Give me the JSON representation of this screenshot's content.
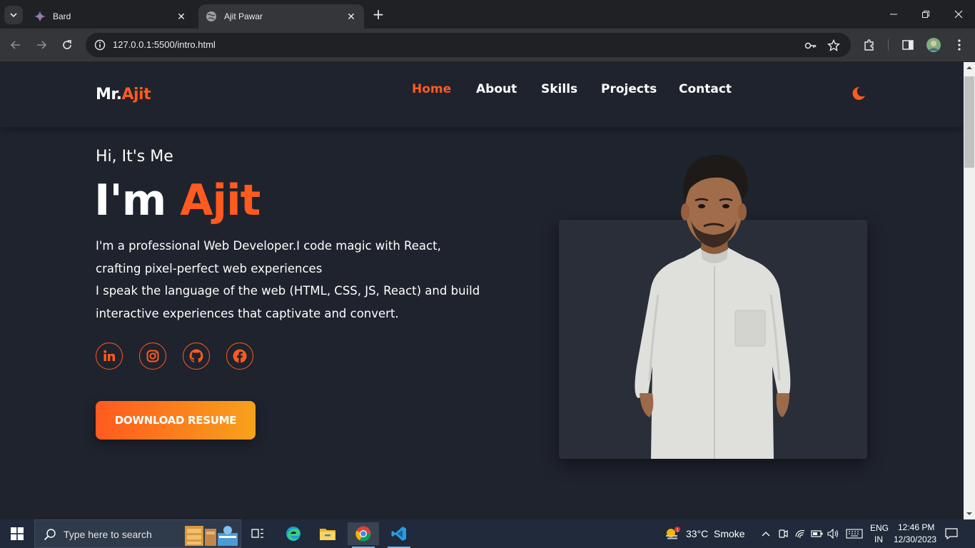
{
  "browser": {
    "tabs": [
      {
        "title": "Bard",
        "icon": "bard-sparkle-icon",
        "active": false
      },
      {
        "title": "Ajit Pawar",
        "icon": "globe-icon",
        "active": true
      }
    ],
    "url": "127.0.0.1:5500/intro.html"
  },
  "site": {
    "logo_prefix": "Mr.",
    "logo_accent": "Ajit",
    "nav": [
      {
        "label": "Home",
        "active": true
      },
      {
        "label": "About",
        "active": false
      },
      {
        "label": "Skills",
        "active": false
      },
      {
        "label": "Projects",
        "active": false
      },
      {
        "label": "Contact",
        "active": false
      }
    ],
    "theme_toggle_icon": "moon-icon"
  },
  "hero": {
    "greeting": "Hi, It's Me",
    "headline_prefix": "I'm ",
    "headline_accent": "Ajit",
    "bio_lines": [
      "I'm a professional Web Developer.I code magic with React,",
      "crafting pixel-perfect web experiences",
      "I speak the language of the web (HTML, CSS, JS, React) and build",
      "interactive experiences that captivate and convert."
    ],
    "social": [
      "linkedin-icon",
      "instagram-icon",
      "github-icon",
      "facebook-icon"
    ],
    "cta_label": "DOWNLOAD RESUME"
  },
  "taskbar": {
    "search_placeholder": "Type here to search",
    "weather_temp": "33°C",
    "weather_desc": "Smoke",
    "lang_top": "ENG",
    "lang_bottom": "IN",
    "time": "12:46 PM",
    "date": "12/30/2023"
  },
  "colors": {
    "accent": "#ff5a1f",
    "accent_gradient_end": "#f7a21b",
    "page_bg": "#1f232d",
    "card_bg": "#2a2e38"
  }
}
